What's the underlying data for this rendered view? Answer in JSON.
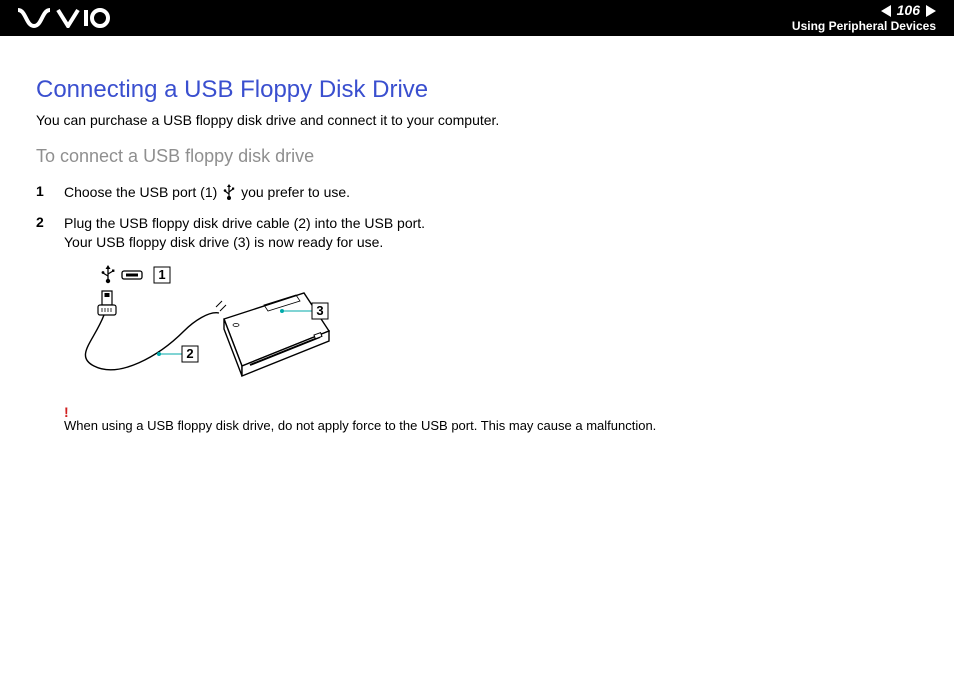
{
  "header": {
    "page_number": "106",
    "section": "Using Peripheral Devices"
  },
  "title": "Connecting a USB Floppy Disk Drive",
  "intro": "You can purchase a USB floppy disk drive and connect it to your computer.",
  "subheading": "To connect a USB floppy disk drive",
  "steps": [
    {
      "num": "1",
      "before_icon": "Choose the USB port (1) ",
      "after_icon": " you prefer to use."
    },
    {
      "num": "2",
      "line1": "Plug the USB floppy disk drive cable (2) into the USB port.",
      "line2": "Your USB floppy disk drive (3) is now ready for use."
    }
  ],
  "diagram": {
    "callout_1": "1",
    "callout_2": "2",
    "callout_3": "3"
  },
  "note": {
    "symbol": "!",
    "text": "When using a USB floppy disk drive, do not apply force to the USB port. This may cause a malfunction."
  }
}
